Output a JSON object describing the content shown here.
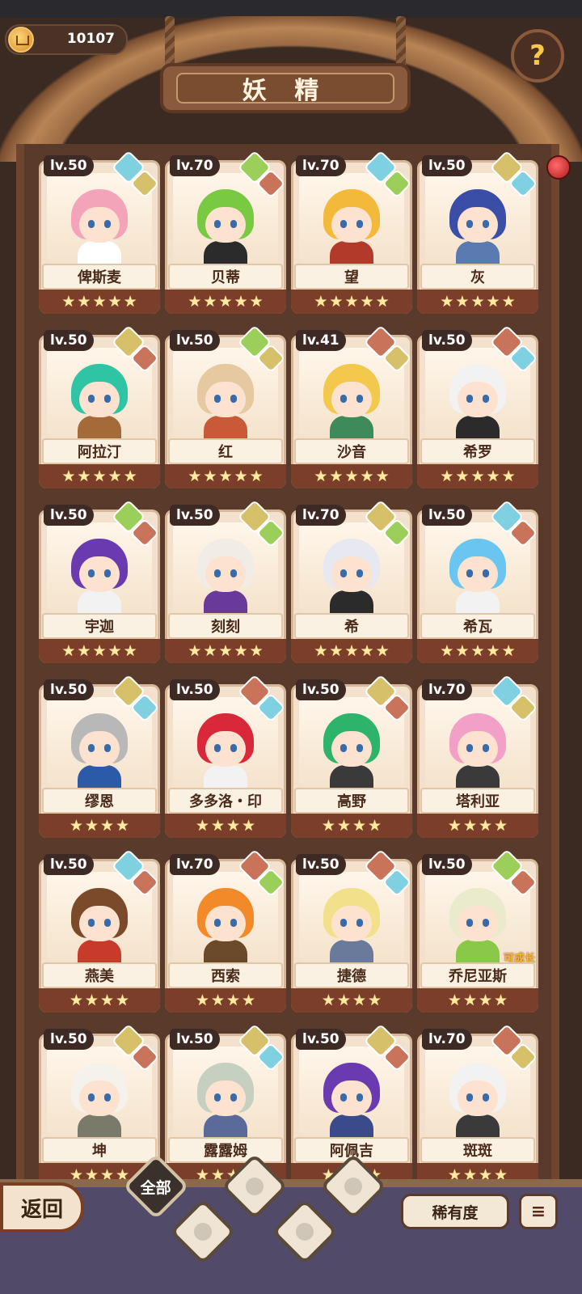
{
  "header": {
    "currency_value": "10107",
    "currency_icon": "crown-coin-icon",
    "title": "妖 精",
    "help_label": "?"
  },
  "fairies": [
    {
      "level": "lv.50",
      "name": "俾斯麦",
      "stars": 5,
      "hair": "#f4a4b8",
      "body": "#ffffff",
      "el": [
        "#7fd0e0",
        "#d6c06a"
      ]
    },
    {
      "level": "lv.70",
      "name": "贝蒂",
      "stars": 5,
      "hair": "#7ac943",
      "body": "#2b2b2b",
      "el": [
        "#9ccf5a",
        "#c9735a"
      ]
    },
    {
      "level": "lv.70",
      "name": "望",
      "stars": 5,
      "hair": "#f2b93b",
      "body": "#b13a2a",
      "el": [
        "#7fd0e0",
        "#9ccf5a"
      ]
    },
    {
      "level": "lv.50",
      "name": "灰",
      "stars": 5,
      "hair": "#3a4ea8",
      "body": "#5a7ab0",
      "el": [
        "#d6c06a",
        "#7fd0e0"
      ]
    },
    {
      "level": "lv.50",
      "name": "阿拉汀",
      "stars": 5,
      "hair": "#2ec4a4",
      "body": "#a56a3a",
      "el": [
        "#d6c06a",
        "#c9735a"
      ]
    },
    {
      "level": "lv.50",
      "name": "红",
      "stars": 5,
      "hair": "#e6c9a0",
      "body": "#c85a3a",
      "el": [
        "#9ccf5a",
        "#d6c06a"
      ]
    },
    {
      "level": "lv.41",
      "name": "沙音",
      "stars": 5,
      "hair": "#f2c94c",
      "body": "#3e8a5a",
      "el": [
        "#c9735a",
        "#d6c06a"
      ]
    },
    {
      "level": "lv.50",
      "name": "希罗",
      "stars": 5,
      "hair": "#f2f2f2",
      "body": "#2b2b2b",
      "el": [
        "#c9735a",
        "#7fd0e0"
      ]
    },
    {
      "level": "lv.50",
      "name": "宇迦",
      "stars": 5,
      "hair": "#6a3ab0",
      "body": "#f2f2f2",
      "el": [
        "#9ccf5a",
        "#c9735a"
      ]
    },
    {
      "level": "lv.50",
      "name": "刻刻",
      "stars": 5,
      "hair": "#f2ece6",
      "body": "#6a3a9a",
      "el": [
        "#d6c06a",
        "#9ccf5a"
      ]
    },
    {
      "level": "lv.70",
      "name": "希",
      "stars": 5,
      "hair": "#e8e8f0",
      "body": "#2b2b2b",
      "el": [
        "#d6c06a",
        "#9ccf5a"
      ]
    },
    {
      "level": "lv.50",
      "name": "希瓦",
      "stars": 5,
      "hair": "#6ac6f0",
      "body": "#f2f2f2",
      "el": [
        "#7fd0e0",
        "#c9735a"
      ]
    },
    {
      "level": "lv.50",
      "name": "缪恩",
      "stars": 4,
      "hair": "#b8b8b8",
      "body": "#2a5aa8",
      "el": [
        "#d6c06a",
        "#7fd0e0"
      ]
    },
    {
      "level": "lv.50",
      "name": "多多洛・印",
      "stars": 4,
      "hair": "#d8283a",
      "body": "#f2f2f2",
      "el": [
        "#c9735a",
        "#7fd0e0"
      ]
    },
    {
      "level": "lv.50",
      "name": "高野",
      "stars": 4,
      "hair": "#2eb46a",
      "body": "#3a3a3a",
      "el": [
        "#d6c06a",
        "#c9735a"
      ]
    },
    {
      "level": "lv.70",
      "name": "塔利亚",
      "stars": 4,
      "hair": "#f2a0c8",
      "body": "#3a3a3a",
      "el": [
        "#7fd0e0",
        "#d6c06a"
      ]
    },
    {
      "level": "lv.50",
      "name": "燕美",
      "stars": 4,
      "hair": "#7a4a2a",
      "body": "#c83a2a",
      "el": [
        "#7fd0e0",
        "#c9735a"
      ]
    },
    {
      "level": "lv.70",
      "name": "西索",
      "stars": 4,
      "hair": "#f28a2a",
      "body": "#6a4a2a",
      "el": [
        "#c9735a",
        "#9ccf5a"
      ]
    },
    {
      "level": "lv.50",
      "name": "捷德",
      "stars": 4,
      "hair": "#f2e08a",
      "body": "#6a7a9a",
      "el": [
        "#c9735a",
        "#7fd0e0"
      ]
    },
    {
      "level": "lv.50",
      "name": "乔尼亚斯",
      "stars": 4,
      "hair": "#eaeacc",
      "body": "#8ac84a",
      "el": [
        "#9ccf5a",
        "#c9735a"
      ],
      "tag": "可成长"
    },
    {
      "level": "lv.50",
      "name": "坤",
      "stars": 4,
      "hair": "#f4f2ea",
      "body": "#7a7a6a",
      "el": [
        "#d6c06a",
        "#c9735a"
      ]
    },
    {
      "level": "lv.50",
      "name": "露露姆",
      "stars": 4,
      "hair": "#c6d0c0",
      "body": "#5a6a9a",
      "el": [
        "#d6c06a",
        "#7fd0e0"
      ]
    },
    {
      "level": "lv.50",
      "name": "阿佩吉",
      "stars": 4,
      "hair": "#6a3ab0",
      "body": "#3a4a8a",
      "el": [
        "#d6c06a",
        "#c9735a"
      ]
    },
    {
      "level": "lv.70",
      "name": "斑斑",
      "stars": 4,
      "hair": "#f2f2f2",
      "body": "#3a3a3a",
      "el": [
        "#c9735a",
        "#d6c06a"
      ]
    }
  ],
  "bottom": {
    "back_label": "返回",
    "filter_all_label": "全部",
    "filters": [
      "tree-element-icon",
      "water-element-icon",
      "earth-element-icon",
      "mountain-element-icon"
    ],
    "rarity_label": "稀有度",
    "sort_icon": "sort-list-icon"
  }
}
